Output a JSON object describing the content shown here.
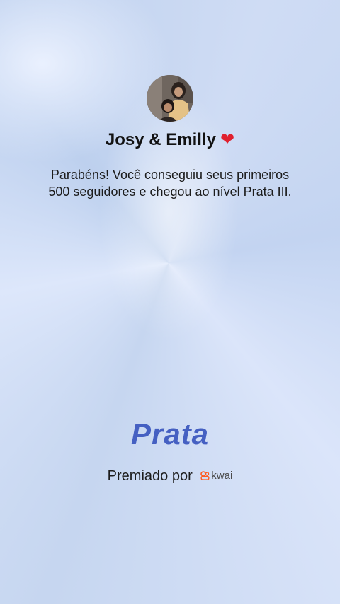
{
  "profile": {
    "name": "Josy & Emilly",
    "avatar_icon": "profile-photo"
  },
  "message": "Parabéns! Você conseguiu seus primeiros 500 seguidores e chegou ao nível Prata III.",
  "level": "Prata",
  "award": {
    "label": "Premiado por",
    "brand": "kwai",
    "brand_color": "#ff5a1f"
  },
  "colors": {
    "accent": "#4560c2",
    "heart": "#e0202e"
  }
}
